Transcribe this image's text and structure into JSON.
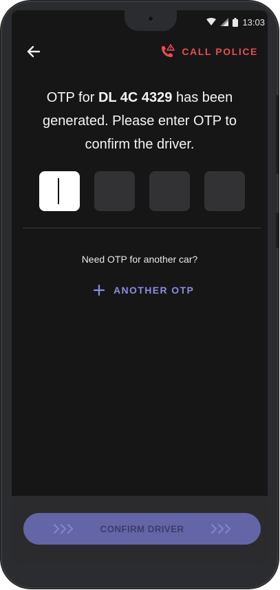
{
  "status_bar": {
    "time": "13:03",
    "icons": [
      "wifi-icon",
      "signal-icon",
      "battery-icon"
    ]
  },
  "header": {
    "back_icon": "arrow-left-icon",
    "call_police_icon": "phone-alert-icon",
    "call_police_label": "CALL POLICE"
  },
  "message": {
    "prefix": "OTP for ",
    "vehicle_number": "DL 4C 4329",
    "suffix": " has been generated. Please enter OTP to confirm the driver."
  },
  "otp": {
    "digits": [
      "",
      "",
      "",
      ""
    ],
    "active_index": 0
  },
  "another": {
    "question": "Need OTP for another car?",
    "button_icon": "plus-icon",
    "button_label": "ANOTHER OTP"
  },
  "confirm": {
    "label": "CONFIRM DRIVER",
    "icon": "triple-chevron-right-icon"
  },
  "colors": {
    "background": "#161617",
    "danger": "#e94d4d",
    "accent": "#8a8ee0",
    "confirm_button": "#6465a6"
  }
}
